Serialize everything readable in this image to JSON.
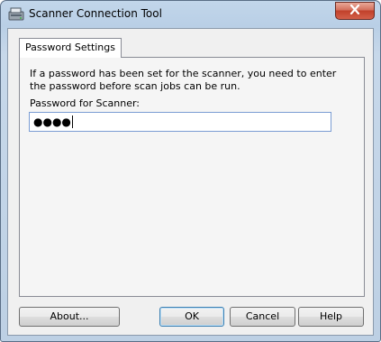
{
  "window": {
    "title": "Scanner Connection Tool"
  },
  "tabs": [
    {
      "label": "Password Settings"
    }
  ],
  "content": {
    "description": "If a password has been set for the scanner, you need to enter the password before scan jobs can be run.",
    "password_label": "Password for Scanner:",
    "password_value": "●●●●"
  },
  "buttons": {
    "about": "About...",
    "ok": "OK",
    "cancel": "Cancel",
    "help": "Help"
  },
  "icons": {
    "app": "scanner-icon",
    "close": "close-icon"
  }
}
